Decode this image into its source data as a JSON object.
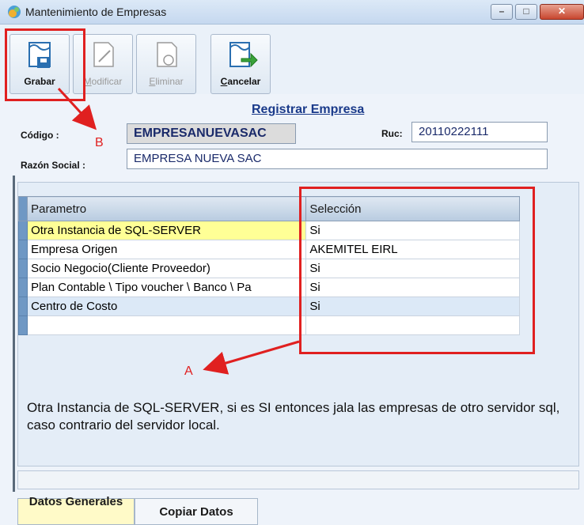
{
  "window": {
    "title": "Mantenimiento de Empresas",
    "min_symbol": "–",
    "max_symbol": "□",
    "close_symbol": "✕"
  },
  "toolbar": {
    "buttons": [
      {
        "label": "Grabar",
        "enabled": true,
        "icon": "save-icon"
      },
      {
        "label": "Modificar",
        "enabled": false,
        "icon": "edit-document-icon"
      },
      {
        "label": "Eliminar",
        "enabled": false,
        "icon": "delete-document-icon"
      },
      {
        "label": "Cancelar",
        "enabled": true,
        "icon": "cancel-icon"
      }
    ]
  },
  "form": {
    "title": "Registrar Empresa",
    "codigo_label": "Código :",
    "codigo_value": "EMPRESANUEVASAC",
    "ruc_label": "Ruc:",
    "ruc_value": "20110222111",
    "razon_label": "Razón Social :",
    "razon_value": "EMPRESA NUEVA SAC"
  },
  "grid": {
    "columns": [
      "Parametro",
      "Selección"
    ],
    "rows": [
      [
        "Otra Instancia de SQL-SERVER",
        "Si"
      ],
      [
        "Empresa Origen",
        "AKEMITEL EIRL"
      ],
      [
        "Socio Negocio(Cliente Proveedor)",
        "Si"
      ],
      [
        "Plan Contable \\ Tipo voucher \\ Banco \\ Pa",
        "Si"
      ],
      [
        "Centro de Costo",
        "Si"
      ],
      [
        "",
        ""
      ]
    ]
  },
  "description": "Otra Instancia de SQL-SERVER, si es SI entonces jala las empresas  de otro servidor sql, caso contrario del servidor local.",
  "tabs": [
    {
      "label": "Datos Generales",
      "active": true
    },
    {
      "label": "Copiar Datos",
      "active": false
    }
  ],
  "annotations": {
    "a": "A",
    "b": "B"
  },
  "colors": {
    "annotation_red": "#e02020",
    "title_blue": "#1a3a8a",
    "highlight_yellow": "#ffff96"
  }
}
